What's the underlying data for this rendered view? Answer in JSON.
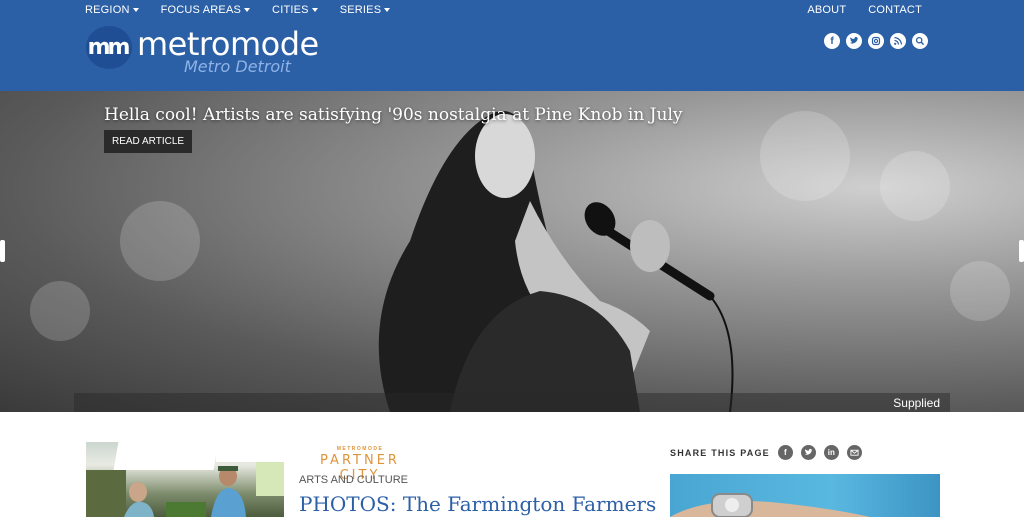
{
  "nav": {
    "left": [
      {
        "label": "REGION"
      },
      {
        "label": "FOCUS AREAS"
      },
      {
        "label": "CITIES"
      },
      {
        "label": "SERIES"
      }
    ],
    "right": [
      {
        "label": "ABOUT"
      },
      {
        "label": "CONTACT"
      }
    ]
  },
  "logo": {
    "badge": "mm",
    "name": "metromode",
    "subtitle": "Metro Detroit"
  },
  "social_icons": [
    "facebook-icon",
    "twitter-icon",
    "instagram-icon",
    "rss-icon",
    "search-icon"
  ],
  "hero": {
    "title": "Hella cool! Artists are satisfying '90s nostalgia at Pine Knob in July",
    "button": "READ ARTICLE",
    "caption": "Supplied"
  },
  "feature": {
    "partner_small": "METROMODE",
    "partner_big": "PARTNER CITY",
    "category": "ARTS AND CULTURE",
    "title": "PHOTOS: The Farmington Farmers"
  },
  "share": {
    "label": "SHARE THIS PAGE",
    "icons": [
      "facebook-icon",
      "twitter-icon",
      "linkedin-icon",
      "email-icon"
    ]
  },
  "colors": {
    "header": "#2b5fa6",
    "accent": "#e0943a",
    "link": "#2b5fa6"
  }
}
